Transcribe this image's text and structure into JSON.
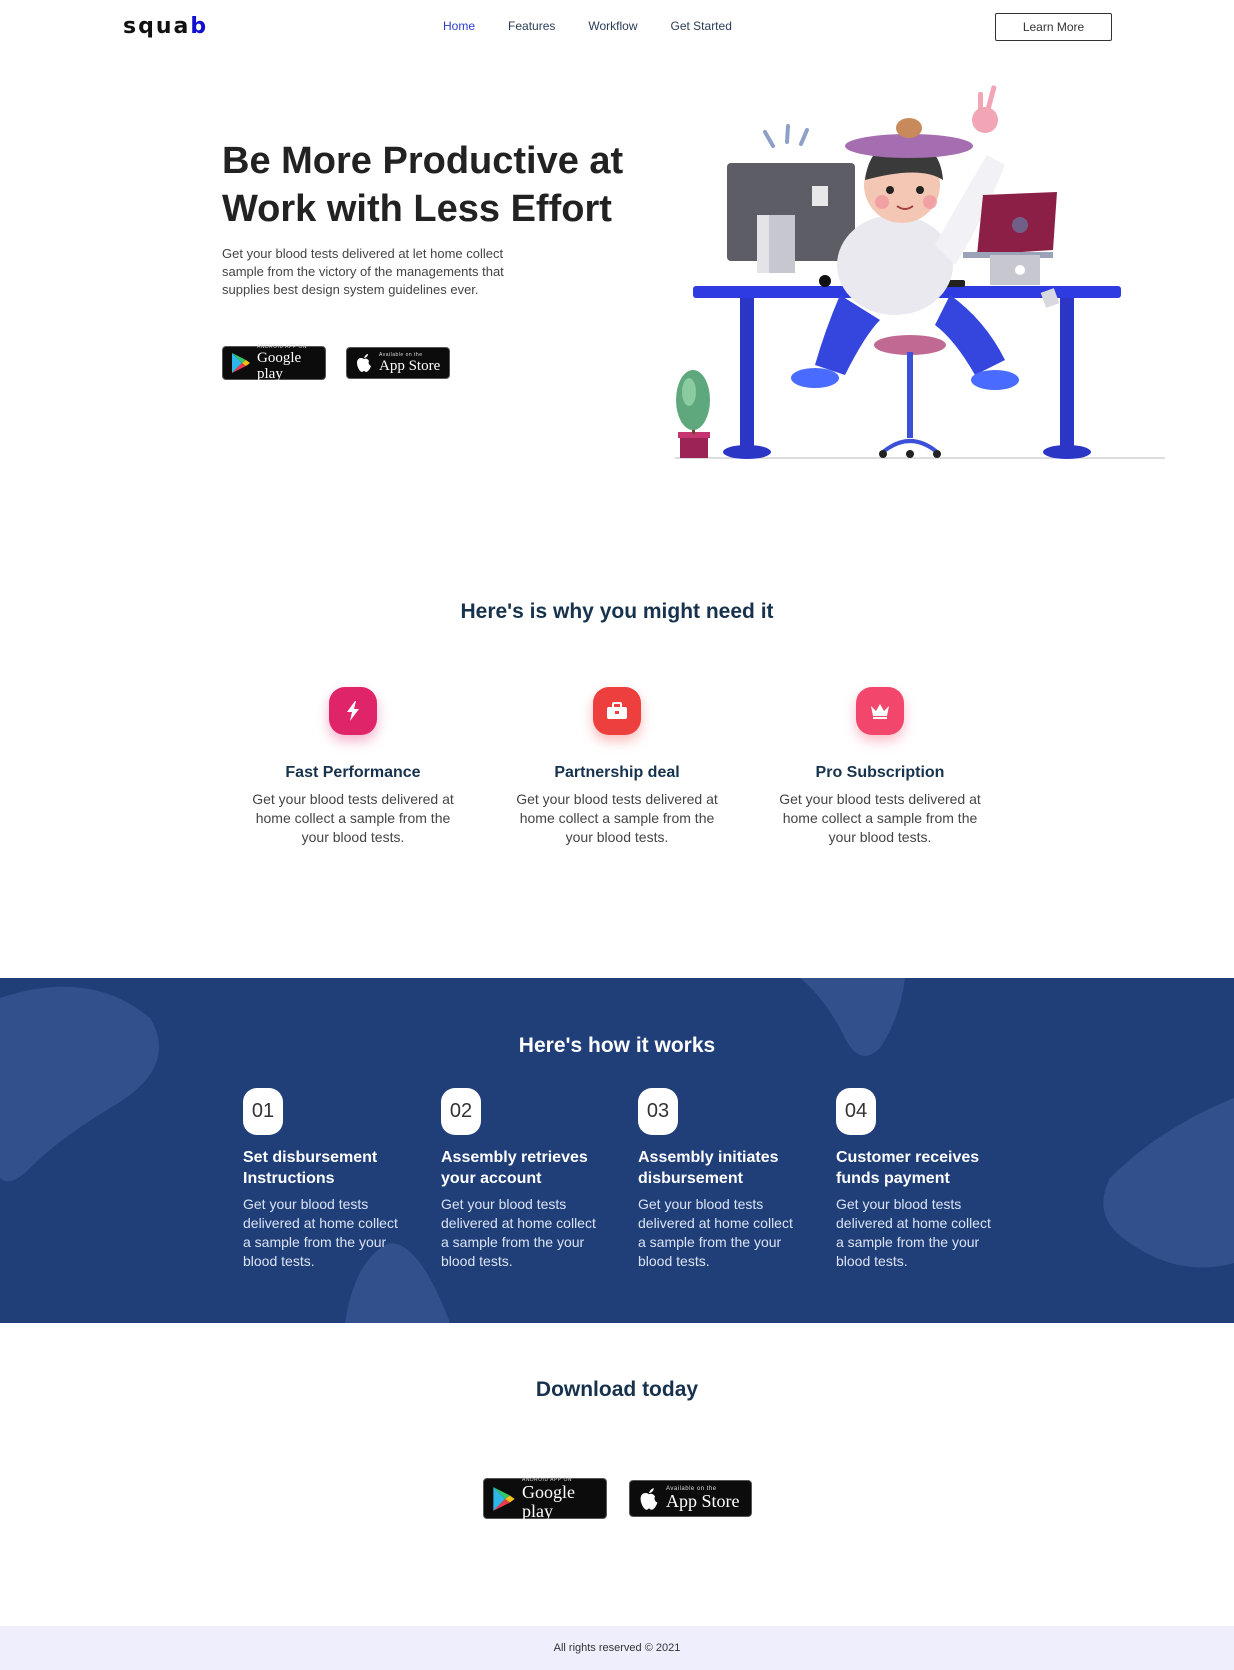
{
  "nav": {
    "logo_main": "squa",
    "logo_accent": "b",
    "links": [
      {
        "label": "Home",
        "active": true
      },
      {
        "label": "Features",
        "active": false
      },
      {
        "label": "Workflow",
        "active": false
      },
      {
        "label": "Get Started",
        "active": false
      }
    ],
    "cta_label": "Learn More"
  },
  "hero": {
    "title": "Be More Productive at Work with Less Effort",
    "text": "Get your blood tests delivered at let home collect sample from the victory of the managements that supplies best design system guidelines ever.",
    "google_play": {
      "small": "ANDROID APP ON",
      "big": "Google play"
    },
    "app_store": {
      "small": "Available on the",
      "big": "App Store"
    }
  },
  "features": {
    "title": "Here's is why you might need it",
    "items": [
      {
        "title": "Fast Performance",
        "text": "Get your blood tests delivered at home collect a sample from the your blood tests.",
        "icon": "lightning-icon",
        "color": "#e0246a"
      },
      {
        "title": "Partnership deal",
        "text": "Get your blood tests delivered at home collect a sample from the your blood tests.",
        "icon": "briefcase-icon",
        "color": "#ee3f3f"
      },
      {
        "title": "Pro Subscription",
        "text": "Get your blood tests delivered at home collect a sample from the your blood tests.",
        "icon": "crown-icon",
        "color": "#f3466d"
      }
    ]
  },
  "how": {
    "title": "Here's how it works",
    "background": "#203f79",
    "steps": [
      {
        "num": "01",
        "title": "Set disbursement Instructions",
        "text": "Get your blood tests delivered at home collect a sample from the your blood tests."
      },
      {
        "num": "02",
        "title": "Assembly retrieves your account",
        "text": "Get your blood tests delivered at home collect a sample from the your blood tests."
      },
      {
        "num": "03",
        "title": "Assembly initiates disbursement",
        "text": "Get your blood tests delivered at home collect a sample from the your blood tests."
      },
      {
        "num": "04",
        "title": "Customer receives funds payment",
        "text": "Get your blood tests delivered at home collect a sample from the your blood tests."
      }
    ]
  },
  "download": {
    "title": "Download today"
  },
  "footer": {
    "text": "All rights reserved © 2021"
  }
}
